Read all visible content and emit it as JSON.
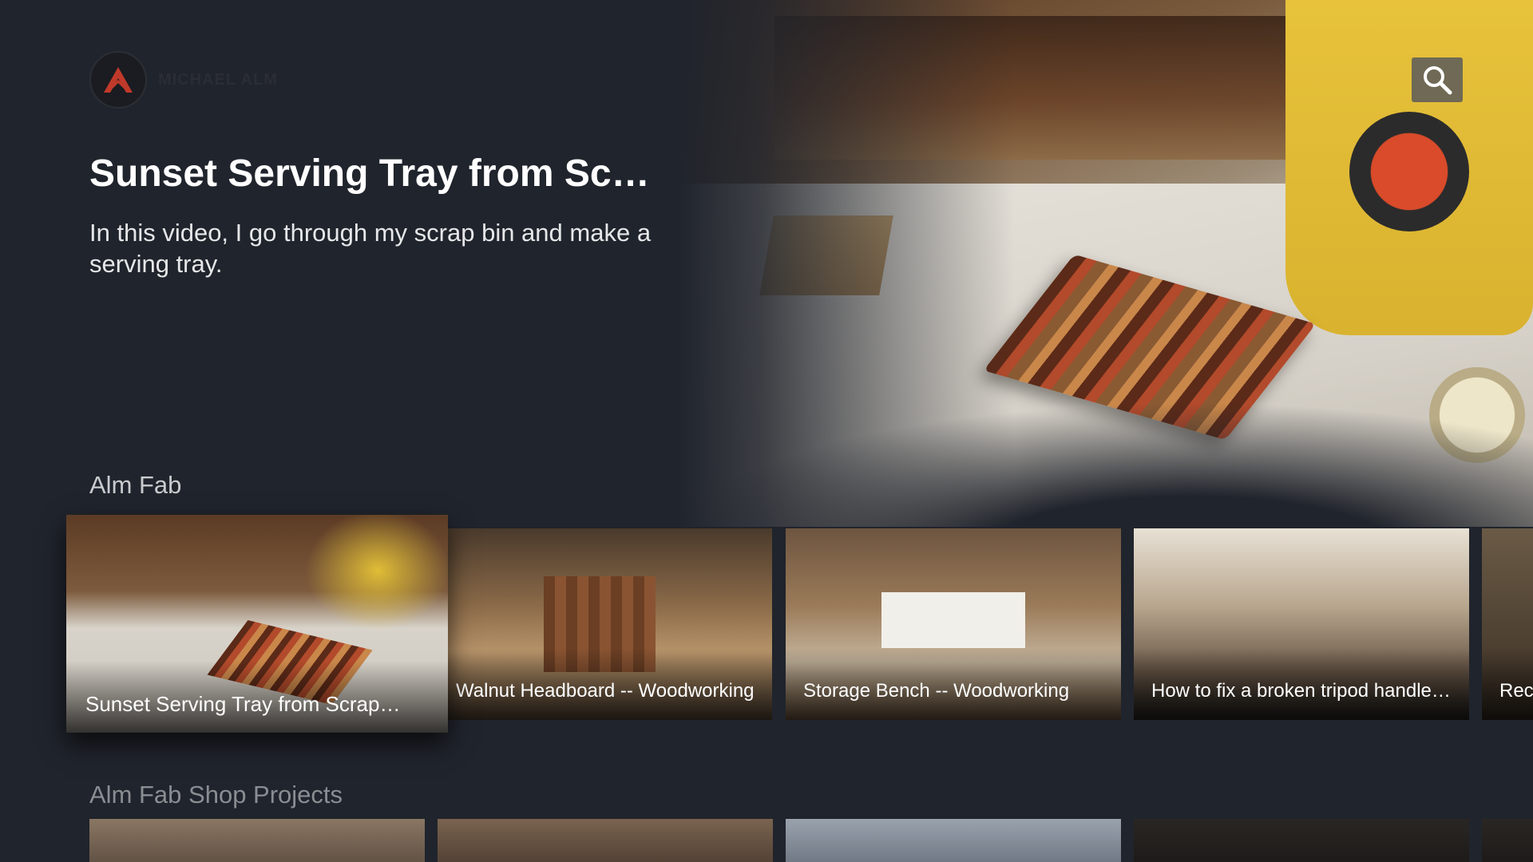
{
  "brand": {
    "logo_icon": "michael-alm-logo",
    "name": "MICHAEL ALM",
    "accent_color": "#c0392b"
  },
  "header": {
    "search_icon": "search-icon"
  },
  "hero": {
    "title": "Sunset Serving Tray from Scra…",
    "description": "In this video, I go through my scrap bin and make a serving tray."
  },
  "rows": [
    {
      "title": "Alm Fab",
      "cards": [
        {
          "label": "Sunset Serving Tray from Scrap…",
          "focused": true
        },
        {
          "label": "Walnut Headboard -- Woodworking"
        },
        {
          "label": "Storage Bench -- Woodworking"
        },
        {
          "label": "How to fix a broken tripod handle …"
        },
        {
          "label": "Rec"
        }
      ]
    },
    {
      "title": "Alm Fab Shop Projects"
    }
  ],
  "colors": {
    "background": "#20242c",
    "text_primary": "#ffffff",
    "text_secondary": "#c9cbce"
  }
}
